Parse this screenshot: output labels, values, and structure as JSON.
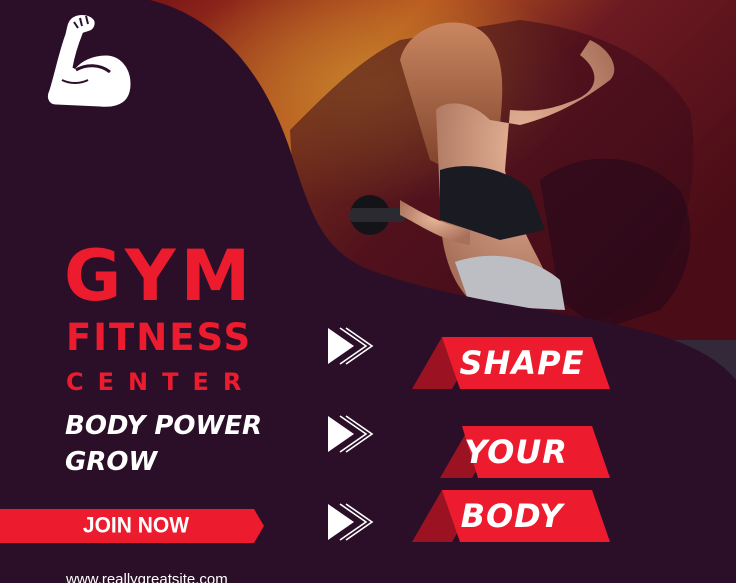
{
  "hero": {
    "line1": "GYM",
    "line2": "FITNESS",
    "line3": "CENTER",
    "tagline": "BODY POWER GROW"
  },
  "cta": {
    "join_label": "JOIN NOW"
  },
  "banners": [
    {
      "label": "SHAPE"
    },
    {
      "label": "YOUR"
    },
    {
      "label": "BODY"
    }
  ],
  "footer": {
    "website": "www.reallygreatsite.com"
  },
  "colors": {
    "accent_red": "#ec1c2e",
    "dark_red": "#9b1322",
    "background_purple": "#2b0f28",
    "text_white": "#ffffff"
  },
  "icons": [
    "flexed-bicep-icon",
    "triple-chevron-right-icon"
  ]
}
